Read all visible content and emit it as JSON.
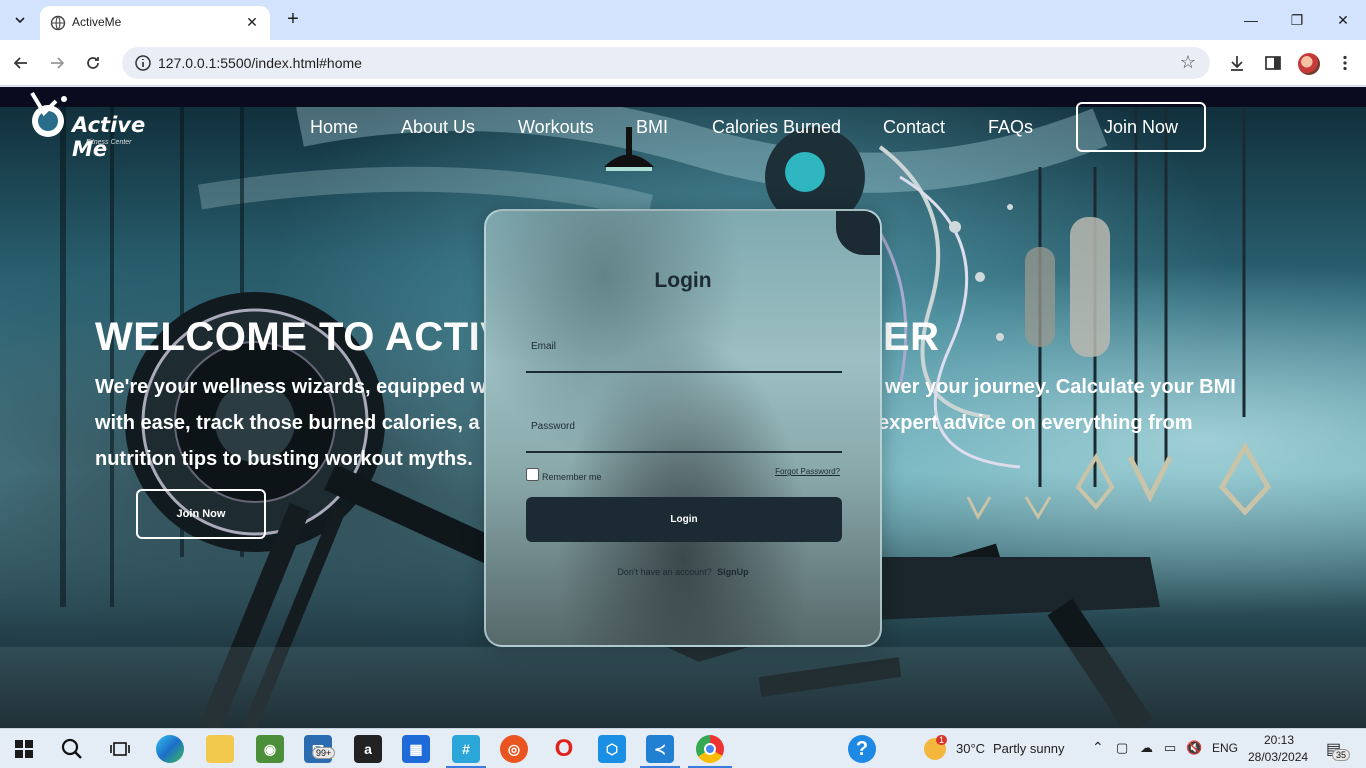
{
  "browser": {
    "tab_title": "ActiveMe",
    "url": "127.0.0.1:5500/index.html#home"
  },
  "site": {
    "logo_text": "Active Me",
    "logo_tagline": "Fitness Center",
    "nav": [
      "Home",
      "About Us",
      "Workouts",
      "BMI",
      "Calories Burned",
      "Contact",
      "FAQs"
    ],
    "join_top": "Join Now"
  },
  "hero": {
    "title_left": "WELCOME TO ACTIV",
    "title_right": "ER",
    "text_left": [
      "We're your wellness wizards, equipped w",
      "with ease, track those burned calories, a",
      "nutrition tips to busting workout myths."
    ],
    "text_right": [
      "wer your journey. Calculate your BMI",
      "expert advice on everything from"
    ],
    "join": "Join Now"
  },
  "login": {
    "title": "Login",
    "email_label": "Email",
    "password_label": "Password",
    "remember": "Remember me",
    "forgot": "Forgot Password?",
    "button": "Login",
    "no_account": "Don't have an account?",
    "signup": "SignUp"
  },
  "taskbar": {
    "mail_badge": "99+",
    "weather_temp": "30°C",
    "weather_text": "Partly sunny",
    "weather_badge": "1",
    "language": "ENG",
    "time": "20:13",
    "date": "28/03/2024",
    "notifications": "35"
  }
}
